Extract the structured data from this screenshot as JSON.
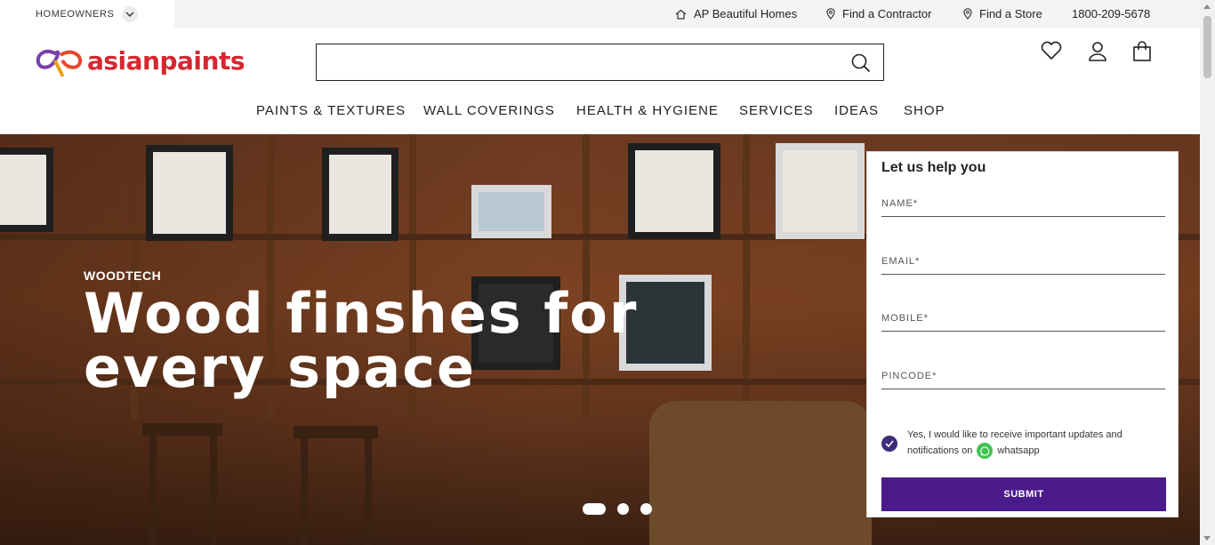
{
  "topbar": {
    "segment_label": "HOMEOWNERS",
    "links": [
      {
        "label": "AP Beautiful Homes",
        "icon": "home-icon"
      },
      {
        "label": "Find a Contractor",
        "icon": "location-pin-icon"
      },
      {
        "label": "Find a Store",
        "icon": "location-pin-icon"
      }
    ],
    "phone": "1800-209-5678"
  },
  "header": {
    "brand": "asianpaints",
    "brand_color": "#d6272f",
    "search_placeholder": "",
    "icons": [
      "heart-icon",
      "user-icon",
      "cart-icon"
    ]
  },
  "nav": {
    "items": [
      "PAINTS & TEXTURES",
      "WALL COVERINGS",
      "HEALTH & HYGIENE",
      "SERVICES",
      "IDEAS",
      "SHOP"
    ]
  },
  "hero": {
    "eyebrow": "WOODTECH",
    "headline": "Wood finshes for every space",
    "slides": 3,
    "active_slide": 1
  },
  "form": {
    "title": "Let us help you",
    "fields": {
      "name": "NAME*",
      "email": "EMAIL*",
      "mobile": "MOBILE*",
      "pincode": "PINCODE*"
    },
    "consent_before": "Yes, I would like to receive important updates and notifications on",
    "consent_after": "whatsapp",
    "consent_checked": true,
    "submit_label": "SUBMIT",
    "accent": "#4b1a8b"
  }
}
